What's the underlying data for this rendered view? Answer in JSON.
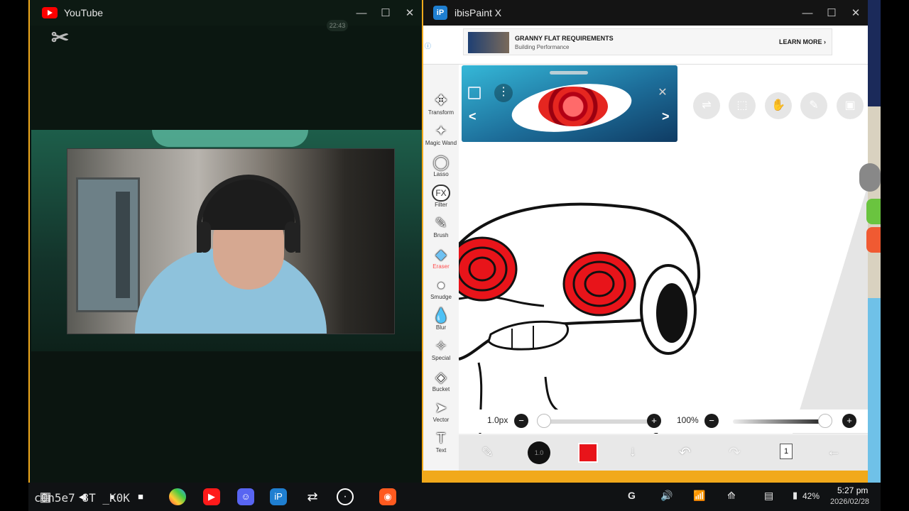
{
  "youtube_window": {
    "title": "YouTube",
    "minimize": "—",
    "maximize": "☐",
    "close": "✕",
    "overlay_time": "22:43",
    "brand_mark": "✂"
  },
  "ibispaint_window": {
    "title": "ibisPaint X",
    "logo": "iP",
    "minimize": "—",
    "maximize": "☐",
    "close": "✕",
    "ad": {
      "headline": "GRANNY FLAT REQUIREMENTS",
      "subline": "Building Performance",
      "cta": "LEARN MORE ›",
      "info": "ⓘ"
    },
    "tools": [
      {
        "label": "Transform",
        "icon": "✥",
        "icon_name": "move-icon"
      },
      {
        "label": "Magic Wand",
        "icon": "✦",
        "icon_name": "magic-wand-icon"
      },
      {
        "label": "Lasso",
        "icon": "◯",
        "icon_name": "lasso-icon"
      },
      {
        "label": "Filter",
        "icon": "FX",
        "icon_name": "filter-icon"
      },
      {
        "label": "Brush",
        "icon": "✎",
        "icon_name": "brush-icon"
      },
      {
        "label": "Eraser",
        "icon": "◆",
        "icon_name": "eraser-icon"
      },
      {
        "label": "Smudge",
        "icon": "●",
        "icon_name": "smudge-icon"
      },
      {
        "label": "Blur",
        "icon": "💧",
        "icon_name": "blur-drop-icon"
      },
      {
        "label": "Special",
        "icon": "✧",
        "icon_name": "special-pen-icon"
      },
      {
        "label": "Bucket",
        "icon": "◈",
        "icon_name": "bucket-icon"
      },
      {
        "label": "Vector",
        "icon": "➤",
        "icon_name": "vector-pointer-icon"
      },
      {
        "label": "Text",
        "icon": "T",
        "icon_name": "text-icon"
      }
    ],
    "reference": {
      "prev": "<",
      "next": ">",
      "menu": "⋮",
      "close": "✕"
    },
    "brush_size": "1.0px",
    "opacity": "100%",
    "minus": "−",
    "plus": "+",
    "brush_size_value": 0.05,
    "opacity_value": 1.0,
    "brush_preview_label": "1.0",
    "current_color": "#e8141a",
    "layer_count": "1",
    "top_icons": [
      "toggle-icon",
      "selection-icon",
      "hand-icon",
      "pen-icon",
      "image-icon"
    ]
  },
  "taskbar": {
    "start": "▦",
    "back": "◀",
    "home": "●",
    "recents": "■",
    "overlay_text": "c0n5e7  8T _K0K",
    "apps": [
      "photos-app-icon",
      "youtube-app-icon",
      "discord-app-icon",
      "ibispaint-app-icon",
      "connect-app-icon",
      "chat-bot-app-icon",
      "screen-recorder-app-icon"
    ],
    "tray": {
      "google": "G",
      "volume": "🔊",
      "wifi": "📶",
      "sync": "⟰",
      "notifications": "▤",
      "battery": "42%",
      "time": "5:27 pm",
      "date": "2026/02/28"
    }
  }
}
